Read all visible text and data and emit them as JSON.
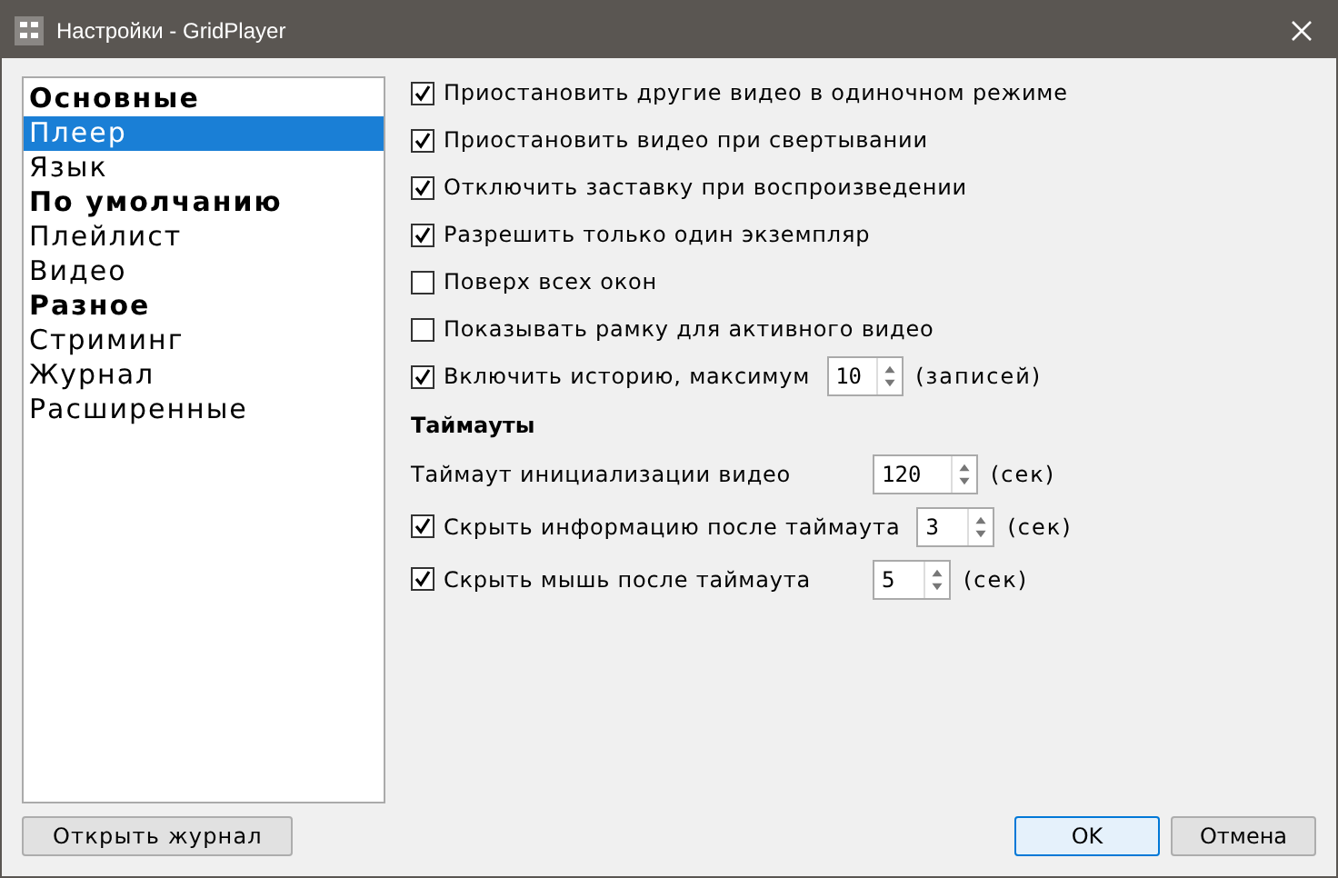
{
  "window": {
    "title": "Настройки - GridPlayer"
  },
  "sidebar": {
    "items": [
      {
        "label": "Основные",
        "kind": "group",
        "selected": false
      },
      {
        "label": "Плеер",
        "kind": "page",
        "selected": true
      },
      {
        "label": "Язык",
        "kind": "page",
        "selected": false
      },
      {
        "label": "По умолчанию",
        "kind": "group",
        "selected": false
      },
      {
        "label": "Плейлист",
        "kind": "page",
        "selected": false
      },
      {
        "label": "Видео",
        "kind": "page",
        "selected": false
      },
      {
        "label": "Разное",
        "kind": "group",
        "selected": false
      },
      {
        "label": "Стриминг",
        "kind": "page",
        "selected": false
      },
      {
        "label": "Журнал",
        "kind": "page",
        "selected": false
      },
      {
        "label": "Расширенные",
        "kind": "page",
        "selected": false
      }
    ]
  },
  "options": [
    {
      "kind": "checkbox",
      "label": "Приостановить другие видео в одиночном режиме",
      "checked": true
    },
    {
      "kind": "checkbox",
      "label": "Приостановить видео при свертывании",
      "checked": true
    },
    {
      "kind": "checkbox",
      "label": "Отключить заставку при воспроизведении",
      "checked": true
    },
    {
      "kind": "checkbox",
      "label": "Разрешить только один экземпляр",
      "checked": true
    },
    {
      "kind": "checkbox",
      "label": "Поверх всех окон",
      "checked": false
    },
    {
      "kind": "checkbox",
      "label": "Показывать рамку для активного видео",
      "checked": false
    },
    {
      "kind": "checkbox_spin",
      "label": "Включить историю, максимум",
      "checked": true,
      "value": "10",
      "unit": "(записей)"
    }
  ],
  "timeouts": {
    "heading": "Таймауты",
    "rows": [
      {
        "kind": "label_spin",
        "label": "Таймаут инициализации видео",
        "value": "120",
        "unit": "(сек)"
      },
      {
        "kind": "checkbox_spin",
        "label": "Скрыть информацию после таймаута",
        "checked": true,
        "value": "3",
        "unit": "(сек)"
      },
      {
        "kind": "checkbox_spin",
        "label": "Скрыть мышь после таймаута",
        "checked": true,
        "value": "5",
        "unit": "(сек)"
      }
    ]
  },
  "buttons": {
    "log": "Открыть журнал",
    "ok": "OK",
    "cancel": "Отмена"
  }
}
